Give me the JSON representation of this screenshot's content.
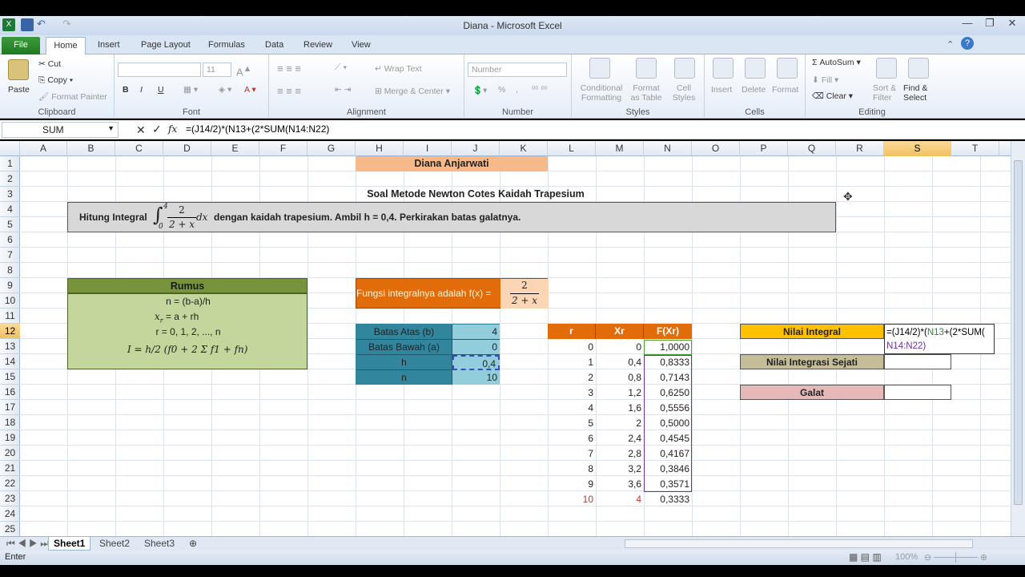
{
  "window": {
    "title": "Diana - Microsoft Excel"
  },
  "tabs": [
    "File",
    "Home",
    "Insert",
    "Page Layout",
    "Formulas",
    "Data",
    "Review",
    "View"
  ],
  "ribbon": {
    "clipboard": {
      "label": "Clipboard",
      "paste": "Paste",
      "cut": "Cut",
      "copy": "Copy",
      "format_painter": "Format Painter"
    },
    "font": {
      "label": "Font",
      "size": "11",
      "bold": "B",
      "italic": "I",
      "underline": "U"
    },
    "alignment": {
      "label": "Alignment",
      "wrap": "Wrap Text",
      "merge": "Merge & Center"
    },
    "number": {
      "label": "Number",
      "format": "Number",
      "percent": "%",
      "comma": ","
    },
    "styles": {
      "label": "Styles",
      "conditional": "Conditional Formatting",
      "format_table": "Format as Table",
      "cell_styles": "Cell Styles"
    },
    "cells": {
      "label": "Cells",
      "insert": "Insert",
      "delete": "Delete",
      "format": "Format"
    },
    "editing": {
      "label": "Editing",
      "autosum": "AutoSum",
      "fill": "Fill",
      "clear": "Clear",
      "sort": "Sort & Filter",
      "find": "Find & Select"
    }
  },
  "formula_bar": {
    "name_box": "SUM",
    "fx": "fx",
    "formula": "=(J14/2)*(N13+(2*SUM(N14:N22)"
  },
  "columns": [
    "A",
    "B",
    "C",
    "D",
    "E",
    "F",
    "G",
    "H",
    "I",
    "J",
    "K",
    "L",
    "M",
    "N",
    "O",
    "P",
    "Q",
    "R",
    "S",
    "T"
  ],
  "rows": [
    "1",
    "2",
    "3",
    "4",
    "5",
    "6",
    "7",
    "8",
    "9",
    "10",
    "11",
    "12",
    "13",
    "14",
    "15",
    "16",
    "17",
    "18",
    "19",
    "20",
    "21",
    "22",
    "23",
    "24",
    "25"
  ],
  "sheet": {
    "author": "Diana Anjarwati",
    "title": "Soal Metode Newton Cotes Kaidah Trapesium",
    "problem_prefix": "Hitung Integral",
    "problem_suffix": "dengan kaidah trapesium. Ambil h = 0,4. Perkirakan batas galatnya.",
    "int_upper": "4",
    "int_lower": "0",
    "int_num": "2",
    "int_den": "2 + x",
    "int_dx": "dx",
    "rumus_header": "Rumus",
    "rumus_1": "n = (b-a)/h",
    "rumus_2": "= a + rh",
    "rumus_2_var": "x",
    "rumus_2_sub": "r",
    "rumus_3": "r = 0, 1, 2, ..., n",
    "rumus_4": "I = h/2 (f0 + 2 Σ f1 + fn)",
    "fungsi_label": "Fungsi integralnya adalah f(x) =",
    "fungsi_num": "2",
    "fungsi_den": "2 + x",
    "params": [
      {
        "label": "Batas Atas (b)",
        "value": "4"
      },
      {
        "label": "Batas Bawah (a)",
        "value": "0"
      },
      {
        "label": "h",
        "value": "0,4"
      },
      {
        "label": "n",
        "value": "10"
      }
    ],
    "table_headers": [
      "r",
      "Xr",
      "F(Xr)"
    ],
    "table": [
      [
        "0",
        "0",
        "1,0000"
      ],
      [
        "1",
        "0,4",
        "0,8333"
      ],
      [
        "2",
        "0,8",
        "0,7143"
      ],
      [
        "3",
        "1,2",
        "0,6250"
      ],
      [
        "4",
        "1,6",
        "0,5556"
      ],
      [
        "5",
        "2",
        "0,5000"
      ],
      [
        "6",
        "2,4",
        "0,4545"
      ],
      [
        "7",
        "2,8",
        "0,4167"
      ],
      [
        "8",
        "3,2",
        "0,3846"
      ],
      [
        "9",
        "3,6",
        "0,3571"
      ],
      [
        "10",
        "4",
        "0,3333"
      ]
    ],
    "nilai_integral": "Nilai Integral",
    "nilai_sejati": "Nilai Integrasi Sejati",
    "galat": "Galat",
    "editing_formula_1": "=(J14/2)*(N13+(2*SUM(",
    "editing_formula_2": "N14:N22)"
  },
  "sheets": [
    "Sheet1",
    "Sheet2",
    "Sheet3"
  ],
  "status": {
    "mode": "Enter",
    "zoom": "100%"
  }
}
